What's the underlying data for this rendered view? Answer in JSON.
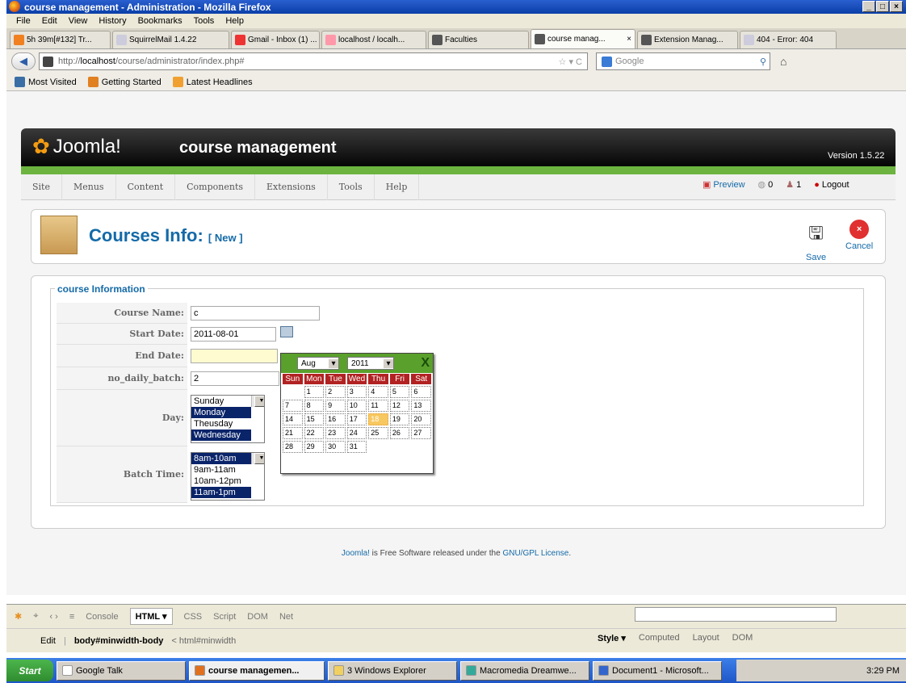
{
  "window": {
    "title": "course management - Administration - Mozilla Firefox"
  },
  "menubar": [
    "File",
    "Edit",
    "View",
    "History",
    "Bookmarks",
    "Tools",
    "Help"
  ],
  "tabs": [
    {
      "label": "5h 39m[#132] Tr...",
      "color": "#f08020"
    },
    {
      "label": "SquirrelMail 1.4.22",
      "color": "#ccd"
    },
    {
      "label": "Gmail - Inbox (1) ...",
      "color": "#e33"
    },
    {
      "label": "localhost / localh...",
      "color": "#f9a"
    },
    {
      "label": "Faculties",
      "color": "#555"
    },
    {
      "label": "course manag...",
      "color": "#555"
    },
    {
      "label": "Extension Manag...",
      "color": "#555"
    },
    {
      "label": "404 - Error: 404",
      "color": "#ccd"
    }
  ],
  "tab_close": "×",
  "url": {
    "prefix": "http://",
    "host": "localhost",
    "path": "/course/administrator/index.php#"
  },
  "search_engine": "Google",
  "bookmarks": [
    "Most Visited",
    "Getting Started",
    "Latest Headlines"
  ],
  "joomla": {
    "logo": "Joomla!",
    "site": "course management",
    "version": "Version 1.5.22"
  },
  "jmenu": [
    "Site",
    "Menus",
    "Content",
    "Components",
    "Extensions",
    "Tools",
    "Help"
  ],
  "jright": {
    "preview": "Preview",
    "messages": "0",
    "users": "1",
    "logout": "Logout"
  },
  "page": {
    "title": "Courses Info:",
    "title_suffix": "[ New ]",
    "save": "Save",
    "cancel": "Cancel"
  },
  "form": {
    "legend": "course Information",
    "course_name_label": "Course Name:",
    "course_name": "c",
    "start_date_label": "Start Date:",
    "start_date": "2011-08-01",
    "end_date_label": "End Date:",
    "end_date": "",
    "batch_label": "no_daily_batch:",
    "batch": "2",
    "day_label": "Day:",
    "days": [
      {
        "t": "Sunday",
        "s": false
      },
      {
        "t": "Monday",
        "s": true
      },
      {
        "t": "Theusday",
        "s": false
      },
      {
        "t": "Wednesday",
        "s": true
      }
    ],
    "batch_time_label": "Batch Time:",
    "times": [
      {
        "t": "8am-10am",
        "s": true
      },
      {
        "t": "9am-11am",
        "s": false
      },
      {
        "t": "10am-12pm",
        "s": false
      },
      {
        "t": "11am-1pm",
        "s": true
      }
    ]
  },
  "calendar": {
    "month": "Aug",
    "year": "2011",
    "close": "X",
    "days": [
      "Sun",
      "Mon",
      "Tue",
      "Wed",
      "Thu",
      "Fri",
      "Sat"
    ],
    "cells": [
      "",
      "1",
      "2",
      "3",
      "4",
      "5",
      "6",
      "7",
      "8",
      "9",
      "10",
      "11",
      "12",
      "13",
      "14",
      "15",
      "16",
      "17",
      "18",
      "19",
      "20",
      "21",
      "22",
      "23",
      "24",
      "25",
      "26",
      "27",
      "28",
      "29",
      "30",
      "31",
      "",
      "",
      ""
    ],
    "today": "18"
  },
  "footer": {
    "pre": "Joomla!",
    "mid": " is Free Software released under the ",
    "link": "GNU/GPL License",
    "post": "."
  },
  "firebug": {
    "tabs": [
      "Console",
      "HTML ▾",
      "CSS",
      "Script",
      "DOM",
      "Net"
    ],
    "active": "HTML ▾",
    "edit": "Edit",
    "path": "body#minwidth-body",
    "path2": "< html#minwidth",
    "side": [
      "Style ▾",
      "Computed",
      "Layout",
      "DOM"
    ]
  },
  "taskbar": {
    "start": "Start",
    "items": [
      "Google Talk",
      "course managemen...",
      "3 Windows Explorer",
      "Macromedia Dreamwe...",
      "Document1 - Microsoft..."
    ],
    "active": "course managemen...",
    "time": "3:29 PM"
  }
}
